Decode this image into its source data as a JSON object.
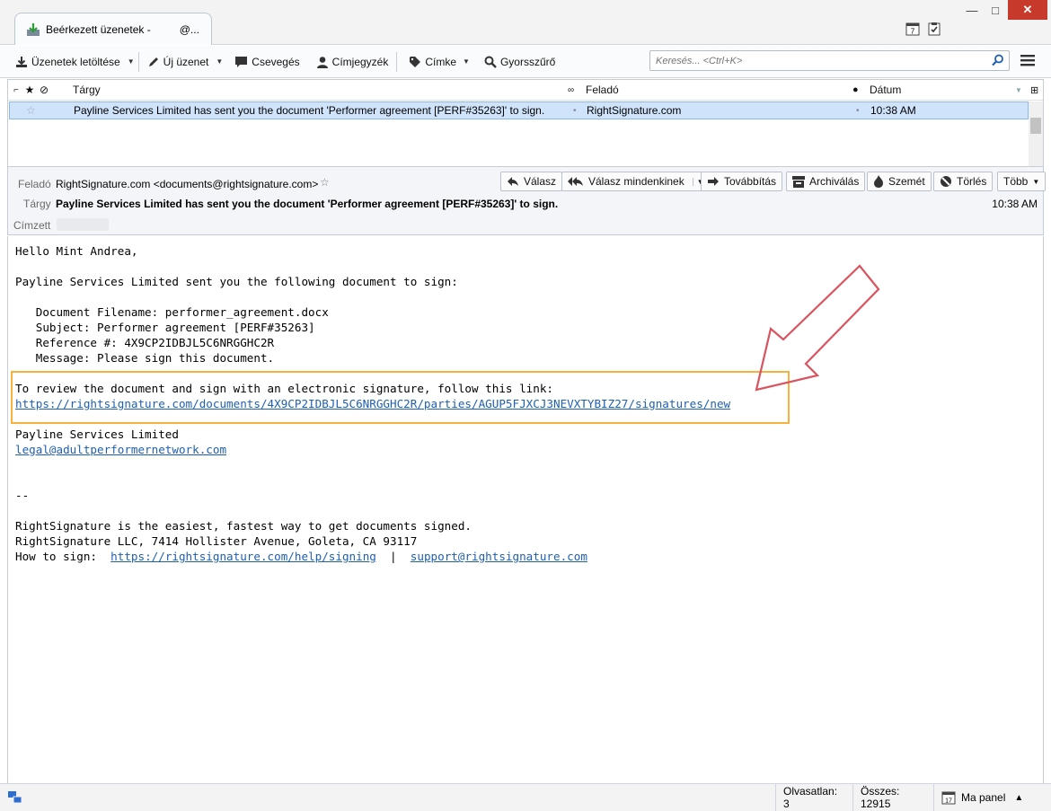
{
  "window": {
    "tab_title": "Beérkezett üzenetek -",
    "tab_account": "@...",
    "minimize": "—",
    "maximize": "□",
    "close": "✕"
  },
  "toolbar": {
    "get_messages": "Üzenetek letöltése",
    "new_message": "Új üzenet",
    "chat": "Csevegés",
    "address_book": "Címjegyzék",
    "tag": "Címke",
    "quick_filter": "Gyorsszűrő",
    "search_placeholder": "Keresés... <Ctrl+K>"
  },
  "thread_pane": {
    "columns": {
      "subject": "Tárgy",
      "from": "Feladó",
      "date": "Dátum"
    },
    "rows": [
      {
        "subject": "Payline Services Limited has sent you the document 'Performer agreement [PERF#35263]' to sign.",
        "from": "RightSignature.com",
        "date": "10:38 AM",
        "selected": true
      }
    ]
  },
  "message_header": {
    "from_label": "Feladó",
    "from_value": "RightSignature.com <documents@rightsignature.com>",
    "subject_label": "Tárgy",
    "subject_value": "Payline Services Limited has sent you the document 'Performer agreement [PERF#35263]' to sign.",
    "to_label": "Címzett",
    "time": "10:38 AM",
    "buttons": {
      "reply": "Válasz",
      "reply_all": "Válasz mindenkinek",
      "forward": "Továbbítás",
      "archive": "Archiválás",
      "junk": "Szemét",
      "delete": "Törlés",
      "more": "Több"
    }
  },
  "body": {
    "greeting": "Hello Mint Andrea,",
    "intro": "Payline Services Limited sent you the following document to sign:",
    "doc_filename": "   Document Filename: performer_agreement.docx",
    "doc_subject": "   Subject: Performer agreement [PERF#35263]",
    "doc_reference": "   Reference #: 4X9CP2IDBJL5C6NRGGHC2R",
    "doc_message": "   Message: Please sign this document.",
    "review_text": "To review the document and sign with an electronic signature, follow this link:",
    "review_link": "https://rightsignature.com/documents/4X9CP2IDBJL5C6NRGGHC2R/parties/AGUP5FJXCJ3NEVXTYBIZ27/signatures/new",
    "sender_name": "Payline Services Limited",
    "sender_email": "legal@adultperformernetwork.com",
    "sig_sep": "--",
    "footer_line1": "RightSignature is the easiest, fastest way to get documents signed.",
    "footer_line2": "RightSignature LLC, 7414 Hollister Avenue, Goleta, CA 93117",
    "footer_how": "How to sign:  ",
    "footer_help_link": "https://rightsignature.com/help/signing",
    "footer_pipe": "  |  ",
    "footer_support_link": "support@rightsignature.com"
  },
  "status_bar": {
    "unread": "Olvasatlan: 3",
    "total": "Összes: 12915",
    "today_pane": "Ma panel",
    "calendar_day": "17"
  },
  "colors": {
    "accent": "#1e5fb3",
    "highlight_box": "#f6b23a",
    "arrow": "#d9545f",
    "selected_row": "#cfe3fb"
  }
}
